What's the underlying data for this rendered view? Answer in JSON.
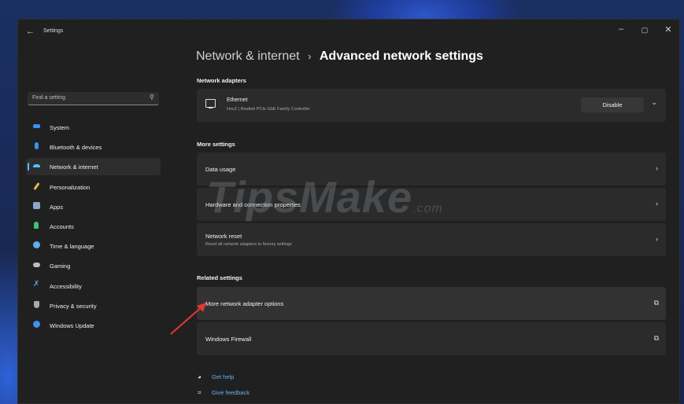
{
  "window": {
    "app_title": "Settings",
    "back_glyph": "←",
    "min_glyph": "–",
    "max_glyph": "▢",
    "close_glyph": "✕"
  },
  "search": {
    "placeholder": "Find a setting",
    "icon": "search-icon"
  },
  "nav": [
    {
      "label": "System",
      "icon": "display-icon",
      "color": "#3e8ff0"
    },
    {
      "label": "Bluetooth & devices",
      "icon": "bluetooth-icon",
      "color": "#3e8ff0"
    },
    {
      "label": "Network & internet",
      "icon": "wifi-icon",
      "color": "#4cc2ff",
      "active": true
    },
    {
      "label": "Personalization",
      "icon": "brush-icon",
      "color": "#e8b74a"
    },
    {
      "label": "Apps",
      "icon": "apps-icon",
      "color": "#8aa8c8"
    },
    {
      "label": "Accounts",
      "icon": "person-icon",
      "color": "#3ec27a"
    },
    {
      "label": "Time & language",
      "icon": "globe-icon",
      "color": "#5ab0f0"
    },
    {
      "label": "Gaming",
      "icon": "controller-icon",
      "color": "#bdbdbd"
    },
    {
      "label": "Accessibility",
      "icon": "accessibility-icon",
      "color": "#4ea6f0"
    },
    {
      "label": "Privacy & security",
      "icon": "shield-icon",
      "color": "#a9a9a9"
    },
    {
      "label": "Windows Update",
      "icon": "update-icon",
      "color": "#3e8ff0"
    }
  ],
  "breadcrumb": {
    "parent": "Network & internet",
    "separator": "›",
    "current": "Advanced network settings"
  },
  "network_adapters": {
    "heading": "Network adapters",
    "adapter": {
      "name": "Ethernet",
      "detail": "HocZ | Realtek PCIe GbE Family Controller",
      "button": "Disable",
      "expand_glyph": "⌄"
    }
  },
  "more_settings": {
    "heading": "More settings",
    "items": [
      {
        "title": "Data usage",
        "subtitle": ""
      },
      {
        "title": "Hardware and connection properties",
        "subtitle": ""
      },
      {
        "title": "Network reset",
        "subtitle": "Reset all network adapters to factory settings"
      }
    ],
    "chevron": "›"
  },
  "related_settings": {
    "heading": "Related settings",
    "items": [
      {
        "title": "More network adapter options"
      },
      {
        "title": "Windows Firewall"
      }
    ],
    "external_glyph": "⧉"
  },
  "help": {
    "get_help": "Get help",
    "give_feedback": "Give feedback"
  },
  "watermark": {
    "text": "TipsMake",
    "suffix": ".com"
  },
  "colors": {
    "accent": "#4cc2ff",
    "window_bg": "#202020",
    "card_bg": "#2b2b2b",
    "link": "#5fb3f5",
    "arrow": "#e03a2e"
  }
}
